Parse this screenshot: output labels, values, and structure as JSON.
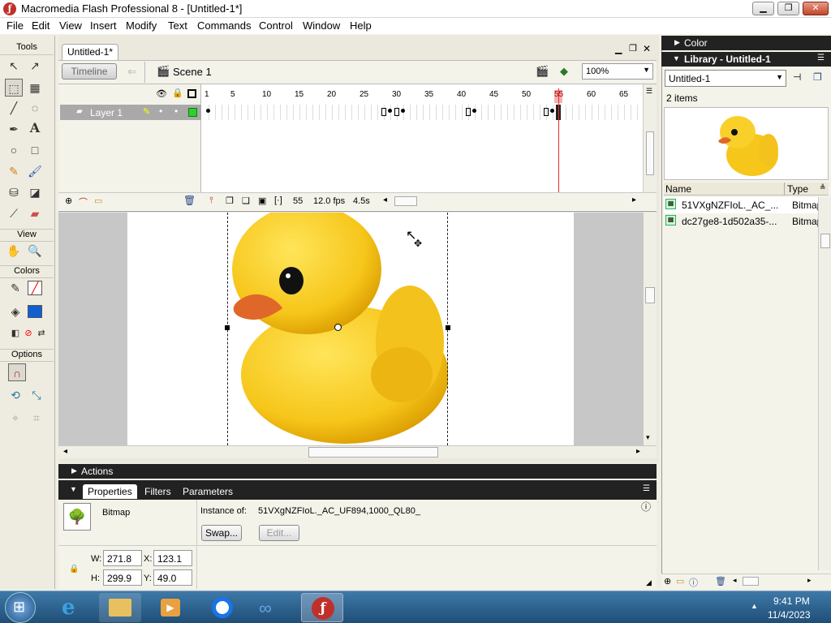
{
  "window": {
    "title": "Macromedia Flash Professional 8 - [Untitled-1*]",
    "buttons": {
      "min": "▁",
      "max": "❐",
      "close": "✕"
    }
  },
  "menu": [
    "File",
    "Edit",
    "View",
    "Insert",
    "Modify",
    "Text",
    "Commands",
    "Control",
    "Window",
    "Help"
  ],
  "tools": {
    "title": "Tools",
    "view_label": "View",
    "colors_label": "Colors",
    "options_label": "Options"
  },
  "document": {
    "tab": "Untitled-1*",
    "timeline_button": "Timeline",
    "scene": "Scene 1",
    "zoom": "100%",
    "layer_name": "Layer 1",
    "ruler_ticks": [
      "1",
      "5",
      "10",
      "15",
      "20",
      "25",
      "30",
      "35",
      "40",
      "45",
      "50",
      "55",
      "60",
      "65"
    ],
    "current_frame": "55",
    "fps": "12.0 fps",
    "elapsed": "4.5s"
  },
  "panels": {
    "actions": "Actions",
    "tabs": [
      "Properties",
      "Filters",
      "Parameters"
    ],
    "props": {
      "type": "Bitmap",
      "instance_label": "Instance of:",
      "instance_value": "51VXgNZFIoL._AC_UF894,1000_QL80_",
      "swap": "Swap...",
      "edit": "Edit...",
      "w_label": "W:",
      "w": "271.8",
      "h_label": "H:",
      "h": "299.9",
      "x_label": "X:",
      "x": "123.1",
      "y_label": "Y:",
      "y": "49.0"
    }
  },
  "library": {
    "color_title": "Color",
    "title": "Library - Untitled-1",
    "doc": "Untitled-1",
    "count": "2 items",
    "col_name": "Name",
    "col_type": "Type",
    "items": [
      {
        "name": "51VXgNZFIoL._AC_...",
        "type": "Bitmap"
      },
      {
        "name": "dc27ge8-1d502a35-...",
        "type": "Bitmap"
      }
    ]
  },
  "taskbar": {
    "time": "9:41 PM",
    "date": "11/4/2023"
  }
}
